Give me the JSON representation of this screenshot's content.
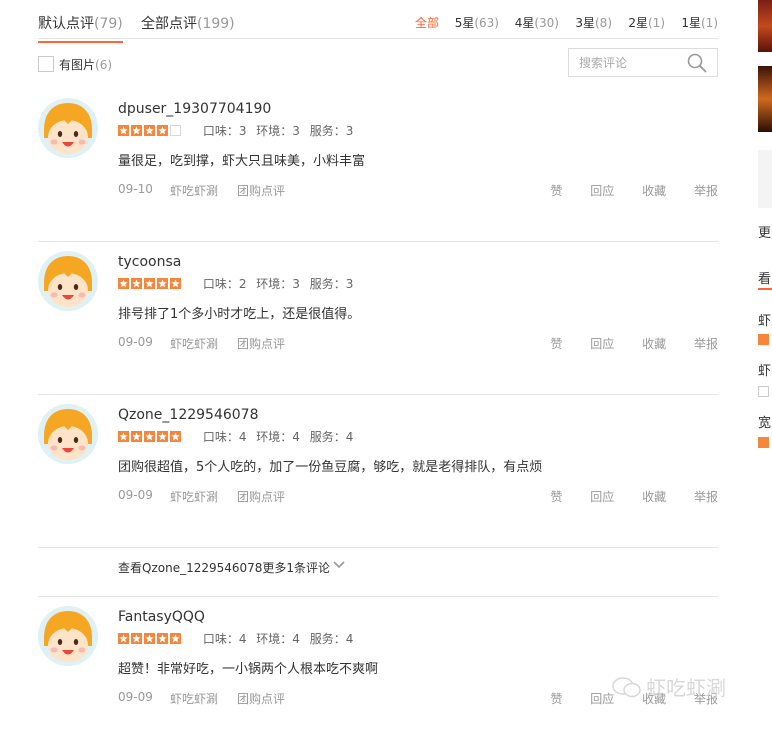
{
  "tabs": [
    {
      "label": "默认点评",
      "count": "(79)"
    },
    {
      "label": "全部点评",
      "count": "(199)"
    }
  ],
  "star_filters": [
    {
      "label": "全部",
      "count": ""
    },
    {
      "label": "5星",
      "count": "(63)"
    },
    {
      "label": "4星",
      "count": "(30)"
    },
    {
      "label": "3星",
      "count": "(8)"
    },
    {
      "label": "2星",
      "count": "(1)"
    },
    {
      "label": "1星",
      "count": "(1)"
    }
  ],
  "filter": {
    "label": "有图片",
    "count": "(6)"
  },
  "search": {
    "placeholder": "搜索评论"
  },
  "actions": {
    "like": "赞",
    "reply": "回应",
    "favorite": "收藏",
    "report": "举报"
  },
  "reviews": [
    {
      "user": "dpuser_19307704190",
      "stars": 4,
      "taste": "口味：3",
      "environment": "环境：3",
      "service": "服务：3",
      "content": "量很足，吃到撑，虾大只且味美，小料丰富",
      "date": "09-10",
      "shop": "虾吃虾涮",
      "source": "团购点评"
    },
    {
      "user": "tycoonsa",
      "stars": 5,
      "taste": "口味：2",
      "environment": "环境：3",
      "service": "服务：3",
      "content": "排号排了1个多小时才吃上，还是很值得。",
      "date": "09-09",
      "shop": "虾吃虾涮",
      "source": "团购点评"
    },
    {
      "user": "Qzone_1229546078",
      "stars": 5,
      "taste": "口味：4",
      "environment": "环境：4",
      "service": "服务：4",
      "content": "团购很超值，5个人吃的，加了一份鱼豆腐，够吃，就是老得排队，有点烦",
      "date": "09-09",
      "shop": "虾吃虾涮",
      "source": "团购点评"
    },
    {
      "user": "FantasyQQQ",
      "stars": 5,
      "taste": "口味：4",
      "environment": "环境：4",
      "service": "服务：4",
      "content": "超赞！非常好吃，一小锅两个人根本吃不爽啊",
      "date": "09-09",
      "shop": "虾吃虾涮",
      "source": "团购点评"
    }
  ],
  "more_link": "查看Qzone_1229546078更多1条评论",
  "right_rail": {
    "more": "更",
    "header": "看",
    "item1": "虾",
    "item2": "虾",
    "item3": "宽"
  },
  "watermark": "虾吃虾涮",
  "colors": {
    "accent": "#ff6633",
    "star": "#f5863b",
    "avatar_hair": "#f5a623"
  }
}
